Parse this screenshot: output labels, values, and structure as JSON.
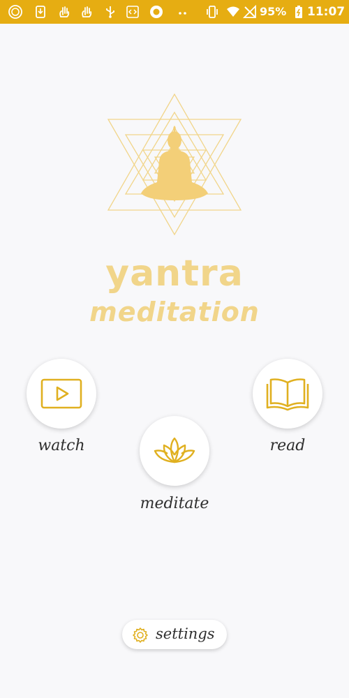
{
  "status_bar": {
    "battery_percent": "95%",
    "time": "11:07",
    "background_color": "#e6ad12",
    "icons": [
      "app-icon",
      "download-icon",
      "hand-icon",
      "hand-icon",
      "usb-icon",
      "code-icon",
      "record-icon",
      "more-dots-icon",
      "vibrate-icon",
      "wifi-icon",
      "no-signal-icon",
      "battery-icon"
    ]
  },
  "app": {
    "title": "yantra",
    "subtitle": "meditation",
    "title_color": "#f1d58a",
    "accent_color": "#e0b020"
  },
  "actions": {
    "watch": {
      "label": "watch",
      "icon": "video-play-icon"
    },
    "read": {
      "label": "read",
      "icon": "open-book-icon"
    },
    "meditate": {
      "label": "meditate",
      "icon": "lotus-icon"
    }
  },
  "settings": {
    "label": "settings",
    "icon": "gear-icon"
  }
}
